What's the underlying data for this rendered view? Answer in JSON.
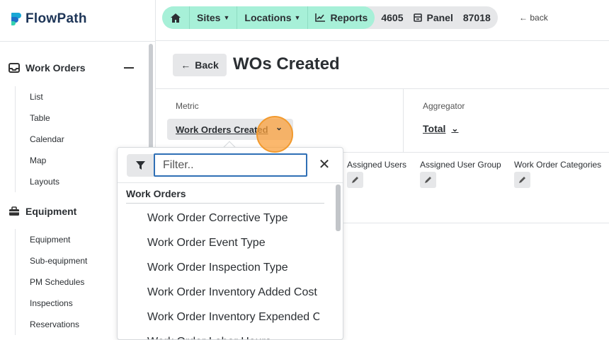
{
  "app": {
    "name": "FlowPath",
    "brand_colors": [
      "#19a8d6",
      "#1e70c8",
      "#36d3b0"
    ]
  },
  "sidebar": {
    "sections": [
      {
        "title": "Work Orders",
        "icon": "inbox-icon",
        "items": [
          "List",
          "Table",
          "Calendar",
          "Map",
          "Layouts"
        ]
      },
      {
        "title": "Equipment",
        "icon": "toolbox-icon",
        "items": [
          "Equipment",
          "Sub-equipment",
          "PM Schedules",
          "Inspections",
          "Reservations"
        ]
      }
    ]
  },
  "breadcrumbs": {
    "home_icon": "home-icon",
    "sites": "Sites",
    "locations": "Locations",
    "reports": "Reports",
    "report_id": "4605",
    "panel": "Panel",
    "panel_id": "87018",
    "back": "back",
    "accent": "#a7f0d8"
  },
  "header": {
    "back_label": "Back",
    "title": "WOs Created"
  },
  "config": {
    "metric_label": "Metric",
    "metric_value": "Work Orders Created",
    "aggregator_label": "Aggregator",
    "aggregator_value": "Total"
  },
  "filters": [
    "Assigned Users",
    "Assigned User Group",
    "Work Order Categories"
  ],
  "dropdown": {
    "placeholder": "Filter..",
    "group": "Work Orders",
    "options": [
      "Work Order Corrective Type",
      "Work Order Event Type",
      "Work Order Inspection Type",
      "Work Order Inventory Added Cost",
      "Work Order Inventory Expended Cost",
      "Work Order Labor Hours"
    ]
  }
}
